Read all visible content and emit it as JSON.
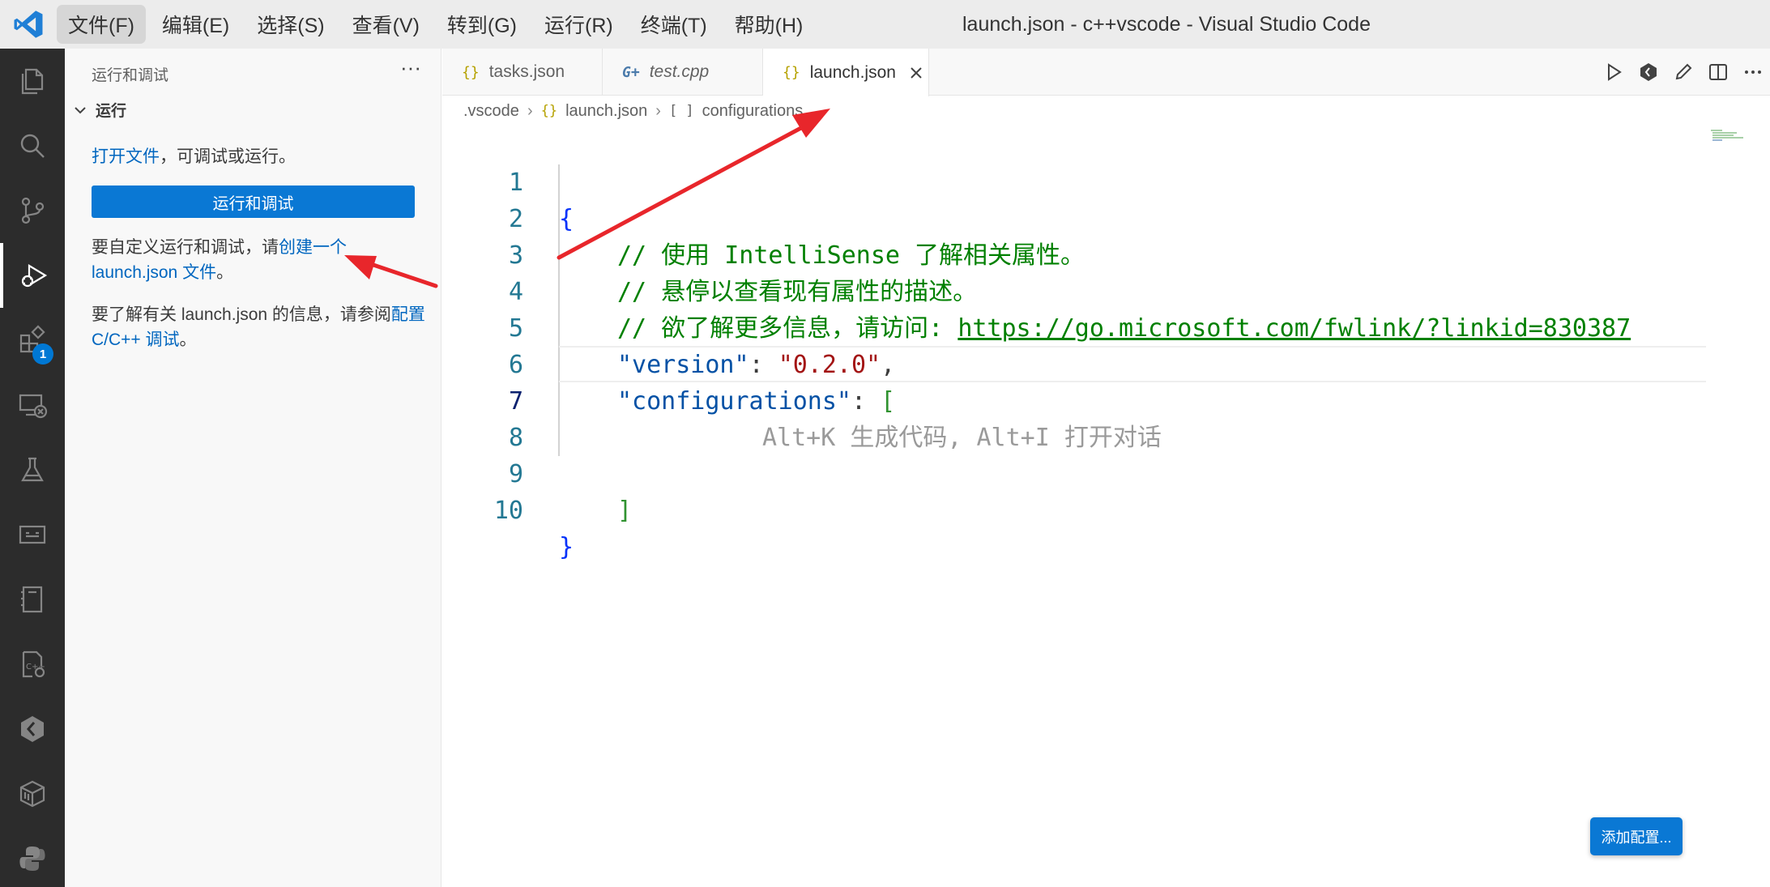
{
  "window": {
    "title": "launch.json - c++vscode - Visual Studio Code"
  },
  "menu": {
    "items": [
      {
        "label": "文件(F)"
      },
      {
        "label": "编辑(E)"
      },
      {
        "label": "选择(S)"
      },
      {
        "label": "查看(V)"
      },
      {
        "label": "转到(G)"
      },
      {
        "label": "运行(R)"
      },
      {
        "label": "终端(T)"
      },
      {
        "label": "帮助(H)"
      }
    ]
  },
  "activity_bar": {
    "items": [
      "explorer-icon",
      "search-icon",
      "source-control-icon",
      "run-debug-icon",
      "extensions-icon",
      "remote-explorer-icon",
      "testing-icon",
      "ports-icon",
      "notebook-icon",
      "cpp-tools-icon",
      "codegeex-icon",
      "package-icon",
      "python-icon"
    ],
    "extensions_badge": "1",
    "accent": "#0078d4"
  },
  "sidebar": {
    "header": "运行和调试",
    "more": "···",
    "section": "运行",
    "open_file_link": "打开文件",
    "open_file_rest": "，可调试或运行。",
    "run_button": "运行和调试",
    "customize_prefix": "要自定义运行和调试，请",
    "customize_link": "创建一个 launch.json 文件",
    "customize_suffix": "。",
    "learn_prefix": "要了解有关 launch.json 的信息，请参阅",
    "learn_link": "配置 C/C++ 调试",
    "learn_suffix": "。"
  },
  "tabs": [
    {
      "label": "tasks.json",
      "icon": "{}"
    },
    {
      "label": "test.cpp",
      "icon": "G+"
    },
    {
      "label": "launch.json",
      "icon": "{}",
      "active": true
    }
  ],
  "breadcrumb": {
    "folder": ".vscode",
    "file_icon": "{}",
    "file": "launch.json",
    "symbol_icon": "[ ]",
    "symbol": "configurations"
  },
  "editor": {
    "line_numbers": [
      "1",
      "2",
      "3",
      "4",
      "5",
      "6",
      "7",
      "8",
      "9",
      "10"
    ],
    "open_brace": "{",
    "line2": "// 使用 IntelliSense 了解相关属性。",
    "line3": "// 悬停以查看现有属性的描述。",
    "line4_prefix": "// 欲了解更多信息，请访问: ",
    "line4_url": "https://go.microsoft.com/fwlink/?linkid=830387",
    "version_key": "\"version\"",
    "version_value": "\"0.2.0\"",
    "config_key": "\"configurations\"",
    "colon": ": ",
    "comma": ",",
    "open_bracket": "[",
    "hint": "Alt+K 生成代码, Alt+I 打开对话",
    "close_bracket": "]",
    "close_brace": "}"
  },
  "add_config_button": "添加配置..."
}
